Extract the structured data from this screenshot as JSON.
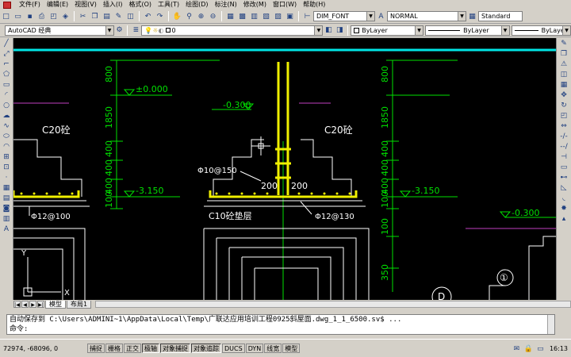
{
  "menu": [
    "文件(F)",
    "编辑(E)",
    "视图(V)",
    "插入(I)",
    "格式(O)",
    "工具(T)",
    "绘图(D)",
    "标注(N)",
    "修改(M)",
    "窗口(W)",
    "帮助(H)"
  ],
  "toolbar": {
    "dimstyle": "DIM_FONT",
    "textstyle": "NORMAL",
    "tablestyle": "Standard",
    "workspace": "AutoCAD 经典",
    "layer": "0",
    "color": "ByLayer",
    "linetype": "ByLayer",
    "lineweight": "ByLayer"
  },
  "drawing": {
    "dims": [
      "800",
      "1850",
      "400",
      "400",
      "400",
      "100",
      "100",
      "350"
    ],
    "elevations": [
      "±0.000",
      "-0.300",
      "-3.150",
      "-3.150",
      "-0.300"
    ],
    "concrete_left": "C20砼",
    "concrete_right": "C20砼",
    "rebar_left": "Φ12@100",
    "rebar_mid": "Φ10@150",
    "rebar_right": "Φ12@130",
    "cushion": "C10砼垫层",
    "dim_200a": "200",
    "dim_200b": "200",
    "grid_label": "①",
    "axis_y": "Y",
    "axis_x": "X",
    "grid_d": "D"
  },
  "tabs": {
    "model": "模型",
    "layout1": "布局1"
  },
  "command": {
    "line1": "自动保存到 C:\\Users\\ADMINI~1\\AppData\\Local\\Temp\\广联达应用培训工程0925斜屋面.dwg_1_1_6500.sv$ ...",
    "prompt": "命令:"
  },
  "status": {
    "coords": "72974, -68096, 0",
    "buttons": [
      "捕捉",
      "栅格",
      "正交",
      "极轴",
      "对象捕捉",
      "对象追踪",
      "DUCS",
      "DYN",
      "线宽",
      "模型"
    ],
    "clock": "16:13"
  },
  "colors": {
    "canvas": "#000000",
    "rebar": "#f0f000",
    "dim": "#00e000",
    "outline": "#ffffff",
    "cyan": "#00e5e5",
    "magenta": "#c040c0"
  }
}
